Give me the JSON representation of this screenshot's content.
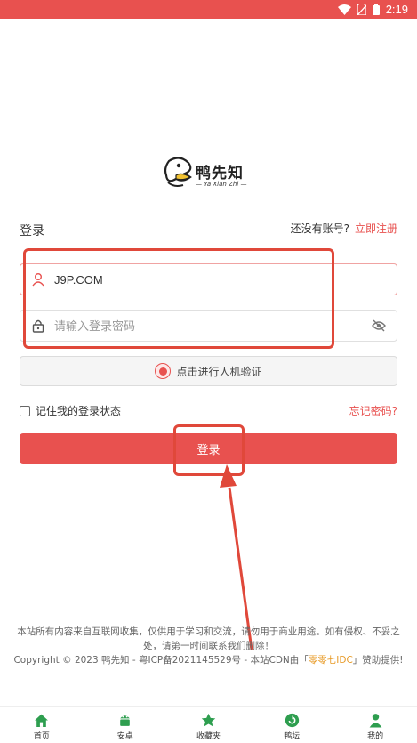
{
  "status_bar": {
    "time": "2:19"
  },
  "brand": {
    "name": "鸭先知",
    "subtitle": "— Ya Xian Zhi —"
  },
  "login_form": {
    "title": "登录",
    "no_account_text": "还没有账号?",
    "register_link": "立即注册",
    "username_value": "J9P.COM",
    "password_placeholder": "请输入登录密码",
    "captcha_label": "点击进行人机验证",
    "remember_label": "记住我的登录状态",
    "forgot_link": "忘记密码?",
    "submit_label": "登录"
  },
  "footer": {
    "notice": "本站所有内容来自互联网收集，仅供用于学习和交流，请勿用于商业用途。如有侵权、不妥之处，请第一时间联系我们删除！",
    "copyright_prefix": "Copyright © 2023 鸭先知 - 粤ICP备2021145529号 - 本站CDN由「",
    "cdn_name": "零零七IDC",
    "copyright_suffix": "」赞助提供!"
  },
  "tabbar": {
    "items": [
      {
        "label": "首页",
        "icon": "home-icon"
      },
      {
        "label": "安卓",
        "icon": "android-icon"
      },
      {
        "label": "收藏夹",
        "icon": "star-icon"
      },
      {
        "label": "鸭坛",
        "icon": "refresh-circle-icon"
      },
      {
        "label": "我的",
        "icon": "user-icon"
      }
    ],
    "accent_color": "#2e9e4f"
  },
  "colors": {
    "brand": "#e8514f",
    "annotation": "#e0483a"
  }
}
